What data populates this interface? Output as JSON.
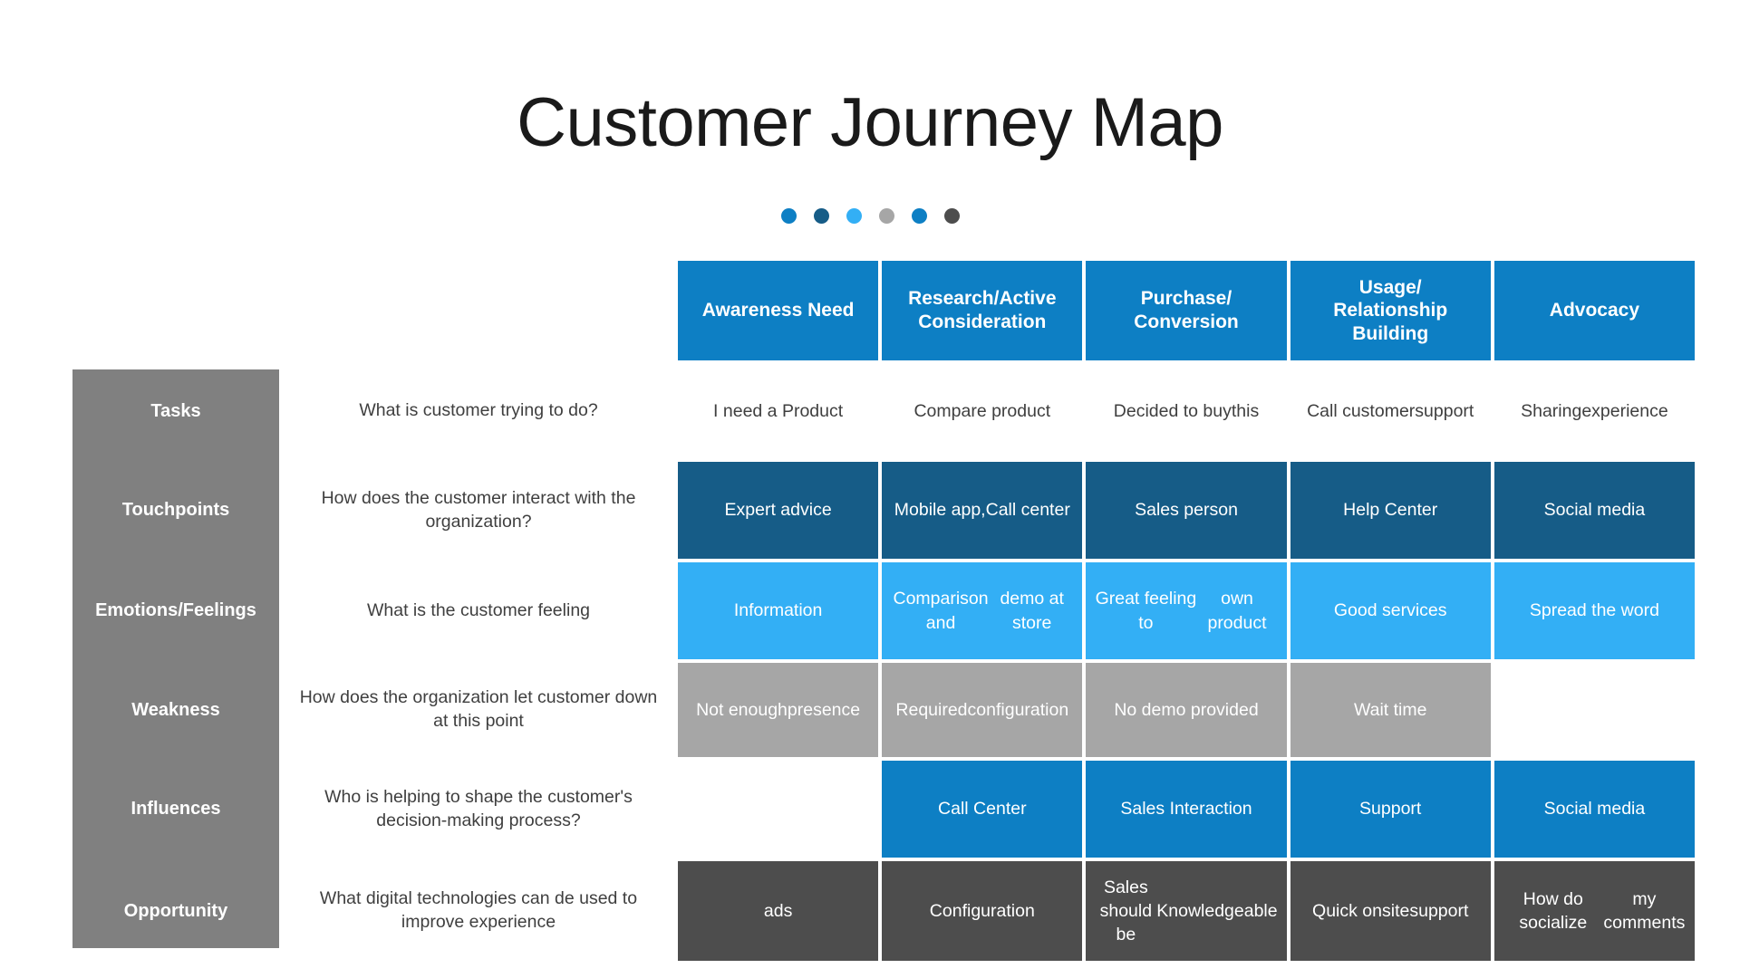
{
  "title": "Customer Journey Map",
  "colors": {
    "primary_blue": "#0D7FC4",
    "dark_navy": "#165C87",
    "light_blue": "#33AFF5",
    "mid_gray": "#A6A6A6",
    "sidebar_gray": "#808080",
    "dark_gray": "#4D4D4D",
    "text_dark": "#3f3f3f",
    "white": "#FFFFFF"
  },
  "dots": [
    {
      "name": "dot-1",
      "color": "#0D7FC4"
    },
    {
      "name": "dot-2",
      "color": "#165C87"
    },
    {
      "name": "dot-3",
      "color": "#33AFF5"
    },
    {
      "name": "dot-4",
      "color": "#A6A6A6"
    },
    {
      "name": "dot-5",
      "color": "#0D7FC4"
    },
    {
      "name": "dot-6",
      "color": "#4D4D4D"
    }
  ],
  "stages": [
    "Awareness Need",
    "Research/Active Consideration",
    "Purchase/ Conversion",
    "Usage/ Relationship Building",
    "Advocacy"
  ],
  "stage_lines": [
    [
      "Awareness Need"
    ],
    [
      "Research/Active",
      "Consideration"
    ],
    [
      "Purchase/",
      "Conversion"
    ],
    [
      "Usage/",
      "Relationship",
      "Building"
    ],
    [
      "Advocacy"
    ]
  ],
  "rows": [
    {
      "label": "Tasks",
      "question": "What is customer trying to do?",
      "cell_bg": "transparent",
      "cell_text_color": "#3f3f3f",
      "cells": [
        "I need a Product",
        "Compare product",
        "Decided to buy this",
        "Call customer support",
        "Sharing experience"
      ]
    },
    {
      "label": "Touchpoints",
      "question": "How does the customer interact with the organization?",
      "cell_bg": "#165C87",
      "cell_text_color": "#FFFFFF",
      "cells": [
        "Expert advice",
        "Mobile app, Call center",
        "Sales person",
        "Help Center",
        "Social media"
      ]
    },
    {
      "label": "Emotions/ Feelings",
      "question": "What is the customer feeling",
      "cell_bg": "#33AFF5",
      "cell_text_color": "#FFFFFF",
      "cells": [
        "Information",
        "Comparison and demo at store",
        "Great feeling to own product",
        "Good services",
        "Spread the word"
      ]
    },
    {
      "label": "Weakness",
      "question": "How does the organization let customer down at this point",
      "cell_bg": "#A6A6A6",
      "cell_text_color": "#FFFFFF",
      "cells": [
        "Not enough presence",
        "Required configuration",
        "No demo provided",
        "Wait time",
        ""
      ]
    },
    {
      "label": "Influences",
      "question": "Who is helping to shape the customer's decision-making process?",
      "cell_bg": "#0D7FC4",
      "cell_text_color": "#FFFFFF",
      "cells": [
        "",
        "Call Center",
        "Sales Interaction",
        "Support",
        "Social media"
      ]
    },
    {
      "label": "Opportunity",
      "question": "What digital technologies can de used to improve experience",
      "cell_bg": "#4D4D4D",
      "cell_text_color": "#FFFFFF",
      "cells": [
        "ads",
        "Configuration",
        "Sales should be Knowledgeable",
        "Quick onsite support",
        "How do socialize my comments"
      ]
    }
  ]
}
